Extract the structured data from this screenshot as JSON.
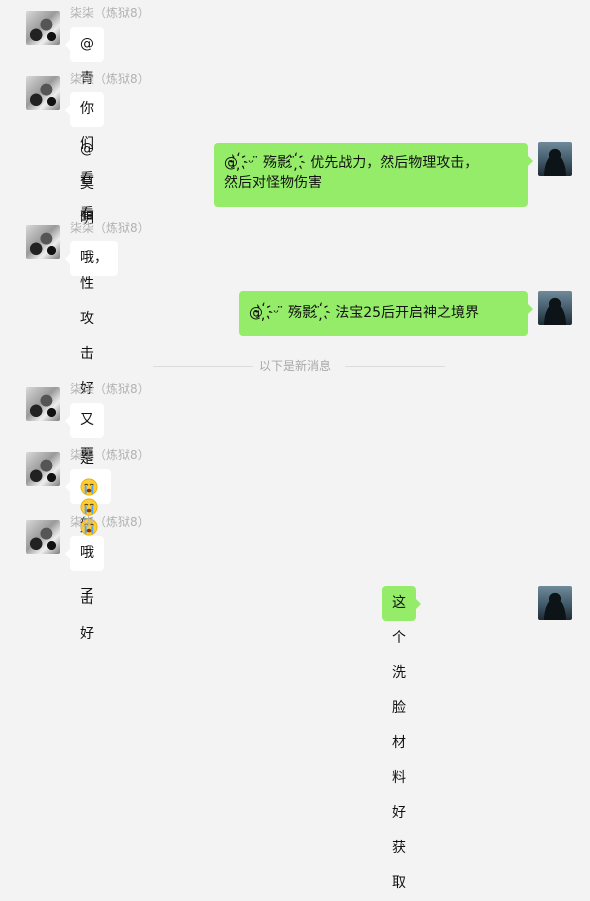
{
  "colors": {
    "background": "#f3f3f3",
    "incoming_bubble": "#ffffff",
    "outgoing_bubble": "#95ec69",
    "sender_name": "#b2b2b2"
  },
  "sender_name": "柒柒（炼狱8）",
  "divider_text": "以下是新消息",
  "messages": [
    {
      "text": "@青莲 @莫明"
    },
    {
      "text": "你们看看属性攻击好还是物理攻击好"
    },
    {
      "line1": "@ ҉ᵕ ̈ 殇影 ̈  ҉  优先战力，然后物理攻击，",
      "line2": "然后对怪物伤害"
    },
    {
      "text": "哦，"
    },
    {
      "text": "@ ҉ᵕ ̈ 殇影 ̈  ҉  法宝25后开启神之境界"
    },
    {
      "text": "又要重新洗了"
    },
    {
      "emoji": "crying-face-emoji",
      "count": 4
    },
    {
      "text": "哦"
    },
    {
      "text": "这个洗脸材料好获取"
    }
  ]
}
